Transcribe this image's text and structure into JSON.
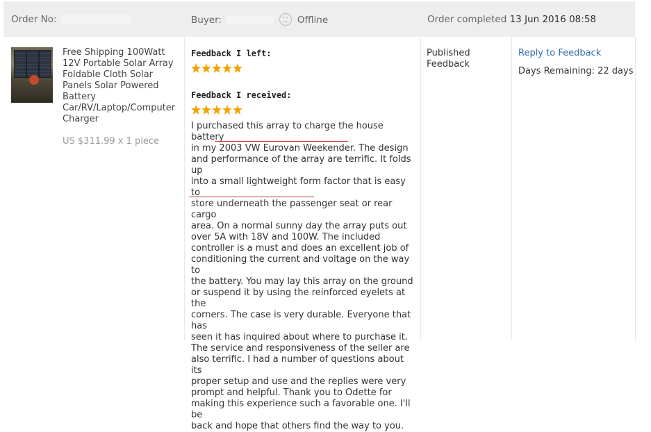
{
  "header": {
    "order_no_label": "Order No:",
    "buyer_label": "Buyer:",
    "buyer_status": "Offline",
    "order_completed_label": "Order completed",
    "order_completed_date": "13 Jun 2016 08:58"
  },
  "product": {
    "title": "Free Shipping 100Watt 12V Portable Solar Array Foldable Cloth Solar Panels Solar Powered Battery Car/RV/Laptop/Computer Charger",
    "price": "US $311.99 x 1 piece"
  },
  "feedback": {
    "left_label": "Feedback I left:",
    "left_stars": 5,
    "received_label": "Feedback I received:",
    "received_stars": 5,
    "review_text": "I purchased this array to charge the house battery\nin my 2003 VW Eurovan Weekender. The design\nand performance of the array are terrific. It folds up\ninto a small lightweight form factor that is easy to\nstore underneath the passenger seat or rear cargo\narea. On a normal sunny day the array puts out\nover 5A with 18V and 100W. The included\ncontroller is a must and does an excellent job of\nconditioning the current and voltage on the way to\nthe battery. You may lay this array on the ground\nor suspend it by using the reinforced eyelets at the\ncorners. The case is very durable. Everyone that has\nseen it has inquired about where to purchase it.\nThe service and responsiveness of the seller are\nalso terrific. I had a number of questions about its\nproper setup and use and the replies were very\nprompt and helpful. Thank you to Odette for\nmaking this experience such a favorable one. I'll be\nback and hope that others find the way to you."
  },
  "status": {
    "line1": "Published",
    "line2": "Feedback"
  },
  "actions": {
    "reply_label": "Reply to Feedback",
    "days_remaining": "Days Remaining: 22 days"
  },
  "colors": {
    "star": "#f2a300",
    "link": "#2e6da4",
    "header_bg": "#eeeeee",
    "underline": "#c0392b"
  }
}
